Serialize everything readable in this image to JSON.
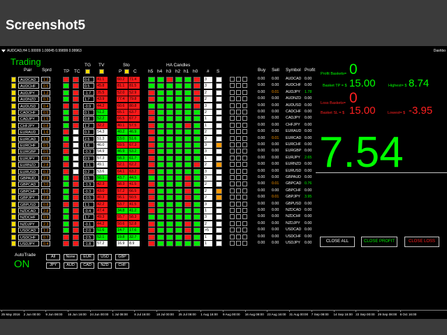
{
  "banner": {
    "title": "Screenshot5"
  },
  "chart_header": {
    "symbol_text": "AUDCAD,H4 1.00009 1.00045 0.99899 0.99963",
    "right_text": "Dashbo"
  },
  "dashboard": {
    "title": "Trading",
    "headers": {
      "pair": "Pair",
      "sprd": "Sprd",
      "tp": "TP",
      "tc": "TC",
      "tg": "TG",
      "tv": "TV",
      "sto": "Sto",
      "p": "P",
      "c": "C",
      "ha": "HA Candles",
      "h5": "h5",
      "h4": "h4",
      "h3": "h3",
      "h2": "h2",
      "h1": "h1",
      "h0": "h0",
      "num": "#",
      "s": "S",
      "buy": "Buy",
      "sell": "Sell",
      "symbol": "Symbol",
      "profit": "Profit"
    },
    "colors": {
      "green": "#00ee00",
      "red": "#ff1a1a",
      "yellow": "#ffdd00",
      "orange": "#ff9900",
      "white": "#ffffff",
      "dark": "#000000",
      "lime_text": "#00ff00",
      "red_text": "#ff2020"
    },
    "rows": [
      {
        "pair": "AUDCAD",
        "sprd": "1.2",
        "sq": "y",
        "tp": "r",
        "tc": "r",
        "tg": "0.6",
        "tv": "41.1",
        "tvc": "r",
        "stoP": "60.2",
        "stoPc": "r",
        "stoC": "71.4",
        "stoCc": "r",
        "ha": [
          "g",
          "g",
          "r",
          "g",
          "g",
          "r"
        ],
        "num": "3",
        "s": "w",
        "buy": "0.00",
        "sell": "0.00",
        "sym": "AUDCAD",
        "profit": "0.00",
        "pc": "w"
      },
      {
        "pair": "AUDCHF",
        "sprd": "0.5",
        "sq": "y",
        "tp": "g",
        "tc": "r",
        "tg": "0.5",
        "tv": "45.8",
        "tvc": "r",
        "stoP": "81.1",
        "stoPc": "r",
        "stoC": "81.5",
        "stoCc": "r",
        "ha": [
          "g",
          "g",
          "g",
          "g",
          "g",
          "r"
        ],
        "num": "3",
        "s": "w",
        "buy": "0.00",
        "sell": "0.00",
        "sym": "AUDCHF",
        "profit": "0.00",
        "pc": "w"
      },
      {
        "pair": "AUDJPY",
        "sprd": "1.2",
        "sq": "y",
        "tp": "g",
        "tc": "r",
        "tg": "-1.7",
        "tv": "35.5",
        "tvc": "r",
        "stoP": "52.0",
        "stoPc": "r",
        "stoC": "52.9",
        "stoCc": "r",
        "ha": [
          "r",
          "g",
          "g",
          "g",
          "g",
          "r"
        ],
        "num": "2",
        "s": "w",
        "buy": "0.00",
        "sell": "0.01",
        "sym": "AUDJPY",
        "profit": "1.78",
        "pc": "g"
      },
      {
        "pair": "AUDNZD",
        "sprd": "0.3",
        "sq": "y",
        "tp": "g",
        "tc": "r",
        "tg": "1.7",
        "tv": "43.9",
        "tvc": "r",
        "stoP": "77.4",
        "stoPc": "r",
        "stoC": "79.8",
        "stoCc": "r",
        "ha": [
          "r",
          "g",
          "g",
          "g",
          "g",
          "r"
        ],
        "num": "2",
        "s": "w",
        "buy": "0.00",
        "sell": "0.00",
        "sym": "AUDNZD",
        "profit": "0.00",
        "pc": "w"
      },
      {
        "pair": "AUDUSD",
        "sprd": "0.4",
        "sq": "y",
        "tp": "r",
        "tc": "r",
        "tg": "-0.9",
        "tv": "44.2",
        "tvc": "r",
        "stoP": "60.6",
        "stoPc": "r",
        "stoC": "80.8",
        "stoCc": "r",
        "ha": [
          "g",
          "g",
          "g",
          "g",
          "g",
          "r"
        ],
        "num": "3",
        "s": "w",
        "buy": "0.00",
        "sell": "0.00",
        "sym": "AUDUSD",
        "profit": "0.00",
        "pc": "w"
      },
      {
        "pair": "CADCHF",
        "sprd": "0.5",
        "sq": "y",
        "tp": "g",
        "tc": "r",
        "tg": "0.1",
        "tv": "51.2",
        "tvc": "g",
        "stoP": "65.1",
        "stoPc": "r",
        "stoC": "63.7",
        "stoCc": "r",
        "ha": [
          "r",
          "g",
          "g",
          "g",
          "g",
          "g"
        ],
        "num": "2",
        "s": "w",
        "buy": "0.00",
        "sell": "0.00",
        "sym": "CADCHF",
        "profit": "0.00",
        "pc": "w"
      },
      {
        "pair": "CADJPY",
        "sprd": "1.5",
        "sq": "y",
        "tp": "g",
        "tc": "r",
        "tg": "0.8",
        "tv": "52.2",
        "tvc": "g",
        "stoP": "66.5",
        "stoPc": "r",
        "stoC": "67.7",
        "stoCc": "r",
        "ha": [
          "r",
          "g",
          "g",
          "g",
          "g",
          "g"
        ],
        "num": "1",
        "s": "w",
        "buy": "0.00",
        "sell": "0.00",
        "sym": "CADJPY",
        "profit": "0.00",
        "pc": "w"
      },
      {
        "pair": "CHFJPY",
        "sprd": "0.8",
        "sq": "y",
        "tp": "g",
        "tc": "r",
        "tg": "1.2",
        "tv": "32.2",
        "tvc": "r",
        "stoP": "40.1",
        "stoPc": "r",
        "stoC": "57.5",
        "stoCc": "r",
        "ha": [
          "r",
          "g",
          "g",
          "g",
          "r",
          "g"
        ],
        "num": "1",
        "s": "w",
        "buy": "0.00",
        "sell": "0.00",
        "sym": "CHFJPY",
        "profit": "0.00",
        "pc": "w"
      },
      {
        "pair": "EURAUD",
        "sprd": "1.6",
        "sq": "y",
        "tp": "r",
        "tc": "w",
        "tg": "0.3",
        "tv": "54.3",
        "tvc": "w",
        "stoP": "40.2",
        "stoPc": "g",
        "stoC": "46.9",
        "stoCc": "g",
        "ha": [
          "r",
          "g",
          "g",
          "g",
          "g",
          "g"
        ],
        "num": "2",
        "s": "w",
        "buy": "0.00",
        "sell": "0.00",
        "sym": "EURAUD",
        "profit": "0.00",
        "pc": "w"
      },
      {
        "pair": "EURCAD",
        "sprd": "1.6",
        "sq": "y",
        "tp": "g",
        "tc": "w",
        "tg": "2.5",
        "tv": "51.3",
        "tvc": "w",
        "stoP": "53.0",
        "stoPc": "g",
        "stoC": "51.6",
        "stoCc": "g",
        "ha": [
          "r",
          "g",
          "g",
          "g",
          "g",
          "g"
        ],
        "num": "3",
        "s": "w",
        "buy": "0.00",
        "sell": "0.01",
        "sym": "EURCAD",
        "profit": "0.00",
        "pc": "w"
      },
      {
        "pair": "EURCHF",
        "sprd": "0.5",
        "sq": "y",
        "tp": "r",
        "tc": "w",
        "tg": "1.6",
        "tv": "46.0",
        "tvc": "w",
        "stoP": "69.5",
        "stoPc": "r",
        "stoC": "67.3",
        "stoCc": "r",
        "ha": [
          "r",
          "g",
          "g",
          "g",
          "g",
          "g"
        ],
        "num": "3",
        "s": "o",
        "buy": "0.00",
        "sell": "0.00",
        "sym": "EURCHF",
        "profit": "0.00",
        "pc": "w"
      },
      {
        "pair": "EURGBP",
        "sprd": "0.5",
        "sq": "y",
        "tp": "r",
        "tc": "w",
        "tg": "-0.3",
        "tv": "54.9",
        "tvc": "w",
        "stoP": "46.9",
        "stoPc": "g",
        "stoC": "53.2",
        "stoCc": "g",
        "ha": [
          "r",
          "g",
          "g",
          "g",
          "g",
          "g"
        ],
        "num": "3",
        "s": "w",
        "buy": "0.00",
        "sell": "0.00",
        "sym": "EURGBP",
        "profit": "0.00",
        "pc": "w"
      },
      {
        "pair": "EURJPY",
        "sprd": "0.8",
        "sq": "y",
        "tp": "g",
        "tc": "w",
        "tg": "0.9",
        "tv": "57.3",
        "tvc": "w",
        "stoP": "58.3",
        "stoPc": "g",
        "stoC": "61.7",
        "stoCc": "g",
        "ha": [
          "r",
          "g",
          "g",
          "g",
          "g",
          "g"
        ],
        "num": "1",
        "s": "w",
        "buy": "0.00",
        "sell": "0.00",
        "sym": "EURJPY",
        "profit": "2.65",
        "pc": "g"
      },
      {
        "pair": "EURNZD",
        "sprd": "2.8",
        "sq": "y",
        "tp": "r",
        "tc": "w",
        "tg": "-1.1",
        "tv": "49.1",
        "tvc": "w",
        "stoP": "52.1",
        "stoPc": "r",
        "stoC": "62.2",
        "stoCc": "r",
        "ha": [
          "r",
          "g",
          "g",
          "g",
          "g",
          "r"
        ],
        "num": "2",
        "s": "o",
        "buy": "0.00",
        "sell": "0.00",
        "sym": "EURNZD",
        "profit": "0.00",
        "pc": "w"
      },
      {
        "pair": "EURUSD",
        "sprd": "0.3",
        "sq": "y",
        "tp": "r",
        "tc": "w",
        "tg": "0.2",
        "tv": "53.6",
        "tvc": "w",
        "stoP": "64.1",
        "stoPc": "r",
        "stoC": "63.2",
        "stoCc": "r",
        "ha": [
          "r",
          "g",
          "g",
          "g",
          "g",
          "g"
        ],
        "num": "3",
        "s": "w",
        "buy": "0.00",
        "sell": "0.00",
        "sym": "EURUSD",
        "profit": "0.00",
        "pc": "w"
      },
      {
        "pair": "GBPAUD",
        "sprd": "2.9",
        "sq": "y",
        "tp": "g",
        "tc": "r",
        "tg": "0.5",
        "tv": "50.1",
        "tvc": "g",
        "stoP": "43.7",
        "stoPc": "g",
        "stoC": "44.5",
        "stoCc": "g",
        "ha": [
          "g",
          "g",
          "g",
          "g",
          "r",
          "g"
        ],
        "num": "3",
        "s": "w",
        "buy": "0.00",
        "sell": "0.00",
        "sym": "GBPAUD",
        "profit": "0.00",
        "pc": "w"
      },
      {
        "pair": "GBPCAD",
        "sprd": "3.0",
        "sq": "y",
        "tp": "g",
        "tc": "r",
        "tg": "-1.3",
        "tv": "42.3",
        "tvc": "r",
        "stoP": "58.3",
        "stoPc": "r",
        "stoC": "41.5",
        "stoCc": "r",
        "ha": [
          "r",
          "g",
          "g",
          "g",
          "r",
          "g"
        ],
        "num": "2",
        "s": "w",
        "buy": "0.00",
        "sell": "0.01",
        "sym": "GBPCAD",
        "profit": "0.76",
        "pc": "g"
      },
      {
        "pair": "GBPCHF",
        "sprd": "1.0",
        "sq": "y",
        "tp": "g",
        "tc": "r",
        "tg": "-0.3",
        "tv": "43.0",
        "tvc": "r",
        "stoP": "57.2",
        "stoPc": "r",
        "stoC": "66.5",
        "stoCc": "r",
        "ha": [
          "r",
          "g",
          "g",
          "g",
          "r",
          "g"
        ],
        "num": "2",
        "s": "o",
        "buy": "0.00",
        "sell": "0.00",
        "sym": "GBPCHF",
        "profit": "0.00",
        "pc": "w"
      },
      {
        "pair": "GBPJPY",
        "sprd": "2.8",
        "sq": "y",
        "tp": "g",
        "tc": "r",
        "tg": "-0.5",
        "tv": "40.3",
        "tvc": "r",
        "stoP": "56.1",
        "stoPc": "r",
        "stoC": "50.5",
        "stoCc": "r",
        "ha": [
          "r",
          "g",
          "g",
          "g",
          "r",
          "g"
        ],
        "num": "2",
        "s": "o",
        "buy": "0.00",
        "sell": "0.01",
        "sym": "GBPJPY",
        "profit": "3.95",
        "pc": "g"
      },
      {
        "pair": "GBPUSD",
        "sprd": "0.8",
        "sq": "y",
        "tp": "r",
        "tc": "r",
        "tg": "1.1",
        "tv": "42.2",
        "tvc": "r",
        "stoP": "53.7",
        "stoPc": "r",
        "stoC": "41.5",
        "stoCc": "r",
        "ha": [
          "r",
          "g",
          "g",
          "g",
          "r",
          "g"
        ],
        "num": "3",
        "s": "w",
        "buy": "0.00",
        "sell": "0.00",
        "sym": "GBPUSD",
        "profit": "0.00",
        "pc": "w"
      },
      {
        "pair": "NZDCAD",
        "sprd": "2.8",
        "sq": "y",
        "tp": "g",
        "tc": "r",
        "tg": "-0.4",
        "tv": "47.4",
        "tvc": "r",
        "stoP": "34.8",
        "stoPc": "g",
        "stoC": "41.2",
        "stoCc": "g",
        "ha": [
          "r",
          "g",
          "g",
          "g",
          "g",
          "g"
        ],
        "num": "1",
        "s": "w",
        "buy": "0.00",
        "sell": "0.00",
        "sym": "NZDCAD",
        "profit": "0.00",
        "pc": "w"
      },
      {
        "pair": "NZDCHF",
        "sprd": "0.9",
        "sq": "y",
        "tp": "g",
        "tc": "r",
        "tg": "1.7",
        "tv": "49.3",
        "tvc": "r",
        "stoP": "55.7",
        "stoPc": "r",
        "stoC": "58.3",
        "stoCc": "r",
        "ha": [
          "g",
          "g",
          "g",
          "g",
          "g",
          "g"
        ],
        "num": "3",
        "s": "w",
        "buy": "0.00",
        "sell": "0.00",
        "sym": "NZDCHF",
        "profit": "0.00",
        "pc": "w"
      },
      {
        "pair": "NZDJPY",
        "sprd": "2.3",
        "sq": "y",
        "tp": "g",
        "tc": "r",
        "tg": "-0.1",
        "tv": "44.2",
        "tvc": "r",
        "stoP": "50.6",
        "stoPc": "r",
        "stoC": "52.8",
        "stoCc": "r",
        "ha": [
          "r",
          "g",
          "g",
          "g",
          "r",
          "g"
        ],
        "num": "2",
        "s": "w",
        "buy": "0.00",
        "sell": "0.00",
        "sym": "NZDJPY",
        "profit": "0.00",
        "pc": "w"
      },
      {
        "pair": "USDCAD",
        "sprd": "1.2",
        "sq": "y",
        "tp": "g",
        "tc": "r",
        "tg": "-2.0",
        "tv": "51.6",
        "tvc": "g",
        "stoP": "14.7",
        "stoPc": "g",
        "stoC": "17.6",
        "stoCc": "g",
        "ha": [
          "r",
          "g",
          "g",
          "g",
          "r",
          "g"
        ],
        "num": ">5",
        "s": "w",
        "buy": "0.00",
        "sell": "0.00",
        "sym": "USDCAD",
        "profit": "0.00",
        "pc": "w"
      },
      {
        "pair": "USDCHF",
        "sprd": "0.7",
        "sq": "y",
        "tp": "r",
        "tc": "r",
        "tg": "-2.5",
        "tv": "52.1",
        "tvc": "g",
        "stoP": "19.8",
        "stoPc": "g",
        "stoC": "32.7",
        "stoCc": "g",
        "ha": [
          "r",
          "g",
          "g",
          "g",
          "r",
          "g"
        ],
        "num": "1",
        "s": "w",
        "buy": "0.00",
        "sell": "0.00",
        "sym": "USDCHF",
        "profit": "0.00",
        "pc": "w"
      },
      {
        "pair": "USDJPY",
        "sprd": "0.4",
        "sq": "y",
        "tp": "r",
        "tc": "r",
        "tg": "-1.8",
        "tv": "57.2",
        "tvc": "w",
        "stoP": "16.9",
        "stoPc": "w",
        "stoC": "8.9",
        "stoCc": "w",
        "ha": [
          "r",
          "g",
          "g",
          "g",
          "g",
          "g"
        ],
        "num": "1",
        "s": "w",
        "buy": "0.00",
        "sell": "0.00",
        "sym": "USDJPY",
        "profit": "0.00",
        "pc": "w"
      }
    ],
    "filter_row1": [
      "All",
      "None",
      "EUR",
      "USD",
      "GBP"
    ],
    "filter_row2": [
      "JPY",
      "AUD",
      "CAD",
      "NZD",
      "CHF"
    ],
    "autotrade_label": "AutoTrade",
    "autotrade_state": "ON"
  },
  "summary": {
    "profit_baskets_label": "Profit Baskets=",
    "profit_baskets_value": "0",
    "basket_tp_label": "Basket TP = $",
    "basket_tp_value": "15.00",
    "highest_label": "Highest= $",
    "highest_value": "8.74",
    "loss_baskets_label": "Loss Baskets=",
    "loss_baskets_value": "0",
    "basket_sl_label": "Basket SL = $",
    "basket_sl_value": "15.00",
    "lowest_label": "Lowest= $",
    "lowest_value": "-3.95",
    "total_value": "7.54",
    "close_all": "CLOSE ALL",
    "close_profit": "CLOSE PROFIT",
    "close_loss": "CLOSE LOSS"
  },
  "time_axis": [
    "25 May 2016",
    "2 Jun 00:00",
    "9 Jun 08:00",
    "16 Jun 16:00",
    "24 Jun 00:00",
    "1 Jul 08:00",
    "8 Jul 16:00",
    "18 Jul 00:00",
    "25 Jul 08:00",
    "1 Aug 16:00",
    "9 Aug 00:00",
    "16 Aug 08:00",
    "23 Aug 16:00",
    "31 Aug 00:00",
    "7 Sep 08:00",
    "14 Sep 16:00",
    "22 Sep 00:00",
    "29 Sep 08:00",
    "6 Oct 16:00"
  ]
}
